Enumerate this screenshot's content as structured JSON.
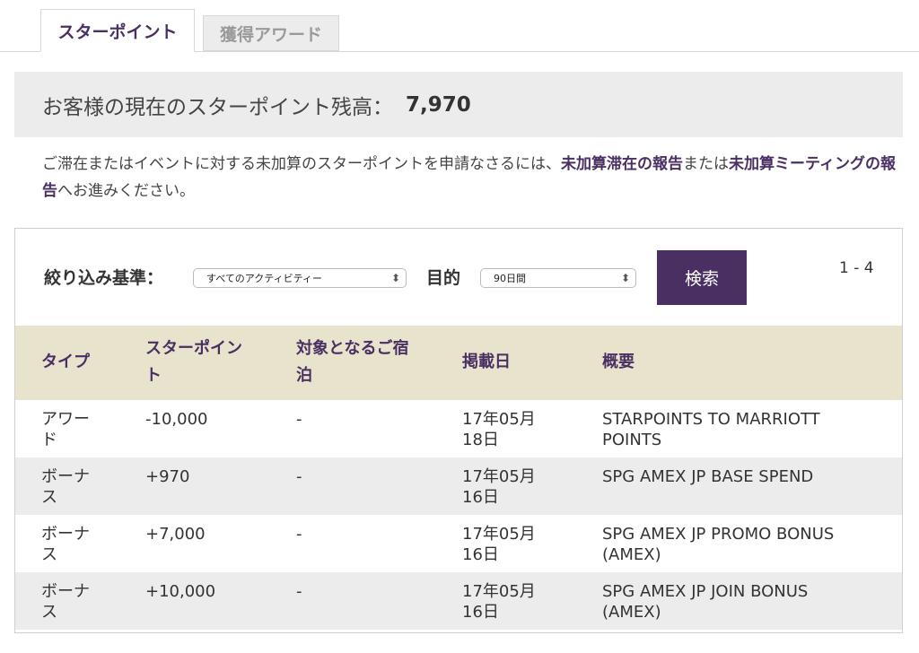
{
  "tabs": [
    {
      "label": "スターポイント",
      "active": true
    },
    {
      "label": "獲得アワード",
      "active": false
    }
  ],
  "balance": {
    "label": "お客様の現在のスターポイント残高：",
    "value": "7,970"
  },
  "note": {
    "text1": "ご滞在またはイベントに対する未加算のスターポイントを申請なさるには、",
    "link1": "未加算滞在の報告",
    "text2": "または",
    "link2": "未加算ミーティングの報告",
    "text3": "へお進みください。"
  },
  "filter": {
    "label": "絞り込み基準：",
    "activity_value": "すべてのアクティビティー",
    "purpose_label": "目的",
    "period_value": "90日間",
    "search_label": "検索",
    "range": "1 - 4"
  },
  "table": {
    "headers": [
      "タイプ",
      "スターポイント",
      "対象となるご宿泊",
      "掲載日",
      "概要"
    ],
    "rows": [
      {
        "type": "アワード",
        "points": "-10,000",
        "stay": "-",
        "date": "17年05月18日",
        "summary": "STARPOINTS TO MARRIOTT POINTS"
      },
      {
        "type": "ボーナス",
        "points": "+970",
        "stay": "-",
        "date": "17年05月16日",
        "summary": "SPG AMEX JP BASE SPEND"
      },
      {
        "type": "ボーナス",
        "points": "+7,000",
        "stay": "-",
        "date": "17年05月16日",
        "summary": "SPG AMEX JP PROMO BONUS (AMEX)"
      },
      {
        "type": "ボーナス",
        "points": "+10,000",
        "stay": "-",
        "date": "17年05月16日",
        "summary": "SPG AMEX JP JOIN BONUS (AMEX)"
      }
    ]
  },
  "colors": {
    "accent": "#4a2f62",
    "header_bg": "#e8e3cc",
    "alt_row": "#ececec"
  }
}
